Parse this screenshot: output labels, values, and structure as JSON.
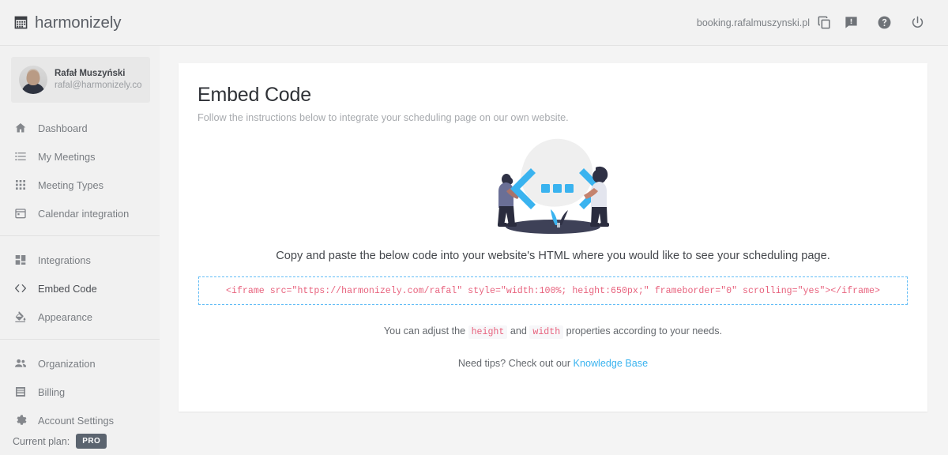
{
  "header": {
    "brand_name": "harmonizely",
    "brand_icon": "calendar-icon",
    "booking_url": "booking.rafalmuszynski.pl",
    "copy_icon": "copy-icon",
    "feedback_icon": "feedback-icon",
    "help_icon": "help-icon",
    "logout_icon": "power-icon"
  },
  "sidebar": {
    "profile": {
      "name": "Rafał Muszyński",
      "email": "rafal@harmonizely.com"
    },
    "groups": [
      {
        "items": [
          {
            "label": "Dashboard",
            "icon": "home-icon",
            "active": false
          },
          {
            "label": "My Meetings",
            "icon": "list-icon",
            "active": false
          },
          {
            "label": "Meeting Types",
            "icon": "grid-icon",
            "active": false
          },
          {
            "label": "Calendar integration",
            "icon": "calendar-icon",
            "active": false
          }
        ]
      },
      {
        "items": [
          {
            "label": "Integrations",
            "icon": "blocks-icon",
            "active": false
          },
          {
            "label": "Embed Code",
            "icon": "code-brackets-icon",
            "active": true
          },
          {
            "label": "Appearance",
            "icon": "paint-bucket-icon",
            "active": false
          }
        ]
      },
      {
        "items": [
          {
            "label": "Organization",
            "icon": "people-icon",
            "active": false
          },
          {
            "label": "Billing",
            "icon": "invoice-icon",
            "active": false
          },
          {
            "label": "Account Settings",
            "icon": "gear-icon",
            "active": false
          }
        ]
      }
    ],
    "plan_label": "Current plan:",
    "plan_badge": "PRO"
  },
  "main": {
    "title": "Embed Code",
    "subtitle": "Follow the instructions below to integrate your scheduling page on our own website.",
    "illustration": "code-brackets-illustration",
    "copy_instruction": "Copy and paste the below code into your website's HTML where you would like to see your scheduling page.",
    "embed_code": "<iframe src=\"https://harmonizely.com/rafal\" style=\"width:100%; height:650px;\" frameborder=\"0\" scrolling=\"yes\"></iframe>",
    "adjust_note": {
      "prefix": "You can adjust the",
      "code_1": "height",
      "middle": "and",
      "code_2": "width",
      "suffix": "properties according to your needs."
    },
    "tips_note": {
      "prefix": "Need tips? Check out our",
      "link": "Knowledge Base"
    }
  },
  "colors": {
    "accent_link": "#3ab3ef",
    "code_text": "#e8637e",
    "dashed_border": "#63bdf6",
    "badge_bg": "#5b646f"
  }
}
